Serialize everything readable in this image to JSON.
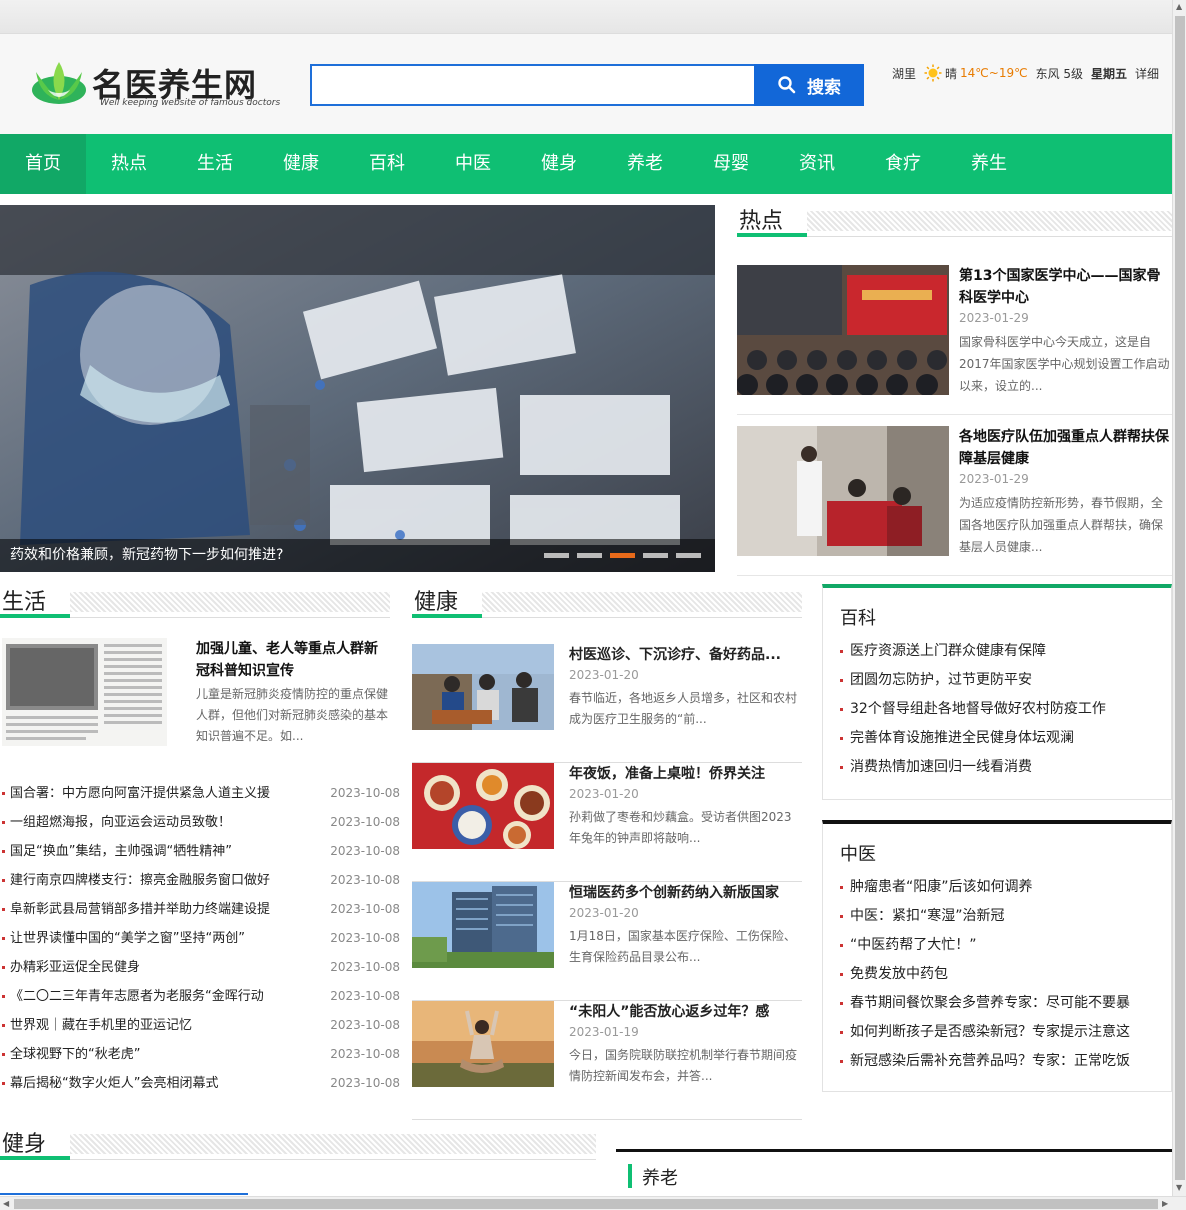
{
  "header": {
    "logo_title": "名医养生网",
    "logo_sub": "Well keeping website of famous doctors",
    "search_placeholder": "",
    "search_label": "搜索",
    "weather": {
      "city": "湖里",
      "condition": "晴",
      "temp": "14℃~19℃",
      "wind": "东风 5级",
      "day": "星期五",
      "detail": "详细"
    }
  },
  "nav": [
    "首页",
    "热点",
    "生活",
    "健康",
    "百科",
    "中医",
    "健身",
    "养老",
    "母婴",
    "资讯",
    "食疗",
    "养生"
  ],
  "slider": {
    "caption": "药效和价格兼顾，新冠药物下一步如何推进?",
    "dots": 5,
    "active_dot": 3
  },
  "sections": {
    "hot": "热点",
    "life": "生活",
    "health": "健康",
    "baike": "百科",
    "tcm": "中医",
    "fitness": "健身",
    "elderly": "养老"
  },
  "hot_items": [
    {
      "title": "第13个国家医学中心——国家骨科医学中心",
      "date": "2023-01-29",
      "summary": "国家骨科医学中心今天成立，这是自2017年国家医学中心规划设置工作启动以来，设立的..."
    },
    {
      "title": "各地医疗队伍加强重点人群帮扶保障基层健康",
      "date": "2023-01-29",
      "summary": "为适应疫情防控新形势，春节假期，全国各地医疗队加强重点人群帮扶，确保基层人员健康..."
    }
  ],
  "life_feature": {
    "title": "加强儿童、老人等重点人群新冠科普知识宣传",
    "summary": "儿童是新冠肺炎疫情防控的重点保健人群，但他们对新冠肺炎感染的基本知识普遍不足。如..."
  },
  "life_list": [
    {
      "title": "国合署：中方愿向阿富汗提供紧急人道主义援",
      "date": "2023-10-08"
    },
    {
      "title": "一组超燃海报，向亚运会运动员致敬！",
      "date": "2023-10-08"
    },
    {
      "title": "国足“换血”集结，主帅强调“牺牲精神”",
      "date": "2023-10-08"
    },
    {
      "title": "建行南京四牌楼支行：擦亮金融服务窗口做好",
      "date": "2023-10-08"
    },
    {
      "title": "阜新彰武县局营销部多措并举助力终端建设提",
      "date": "2023-10-08"
    },
    {
      "title": "让世界读懂中国的“美学之窗”坚持“两创”",
      "date": "2023-10-08"
    },
    {
      "title": "办精彩亚运促全民健身",
      "date": "2023-10-08"
    },
    {
      "title": "《二〇二三年青年志愿者为老服务“金晖行动",
      "date": "2023-10-08"
    },
    {
      "title": "世界观｜藏在手机里的亚运记忆",
      "date": "2023-10-08"
    },
    {
      "title": "全球视野下的“秋老虎”",
      "date": "2023-10-08"
    },
    {
      "title": "幕后揭秘“数字火炬人”会亮相闭幕式",
      "date": "2023-10-08"
    }
  ],
  "health_items": [
    {
      "title": "村医巡诊、下沉诊疗、备好药品...",
      "date": "2023-01-20",
      "summary": "春节临近，各地返乡人员增多，社区和农村成为医疗卫生服务的“前..."
    },
    {
      "title": "年夜饭，准备上桌啦！侨界关注",
      "date": "2023-01-20",
      "summary": "孙莉做了枣卷和炒藕盒。受访者供图2023年兔年的钟声即将敲响..."
    },
    {
      "title": "恒瑞医药多个创新药纳入新版国家",
      "date": "2023-01-20",
      "summary": "1月18日，国家基本医疗保险、工伤保险、生育保险药品目录公布..."
    },
    {
      "title": "“未阳人”能否放心返乡过年？感",
      "date": "2023-01-19",
      "summary": "今日，国务院联防联控机制举行春节期间疫情防控新闻发布会，并答..."
    }
  ],
  "baike_list": [
    "医疗资源送上门群众健康有保障",
    "团圆勿忘防护，过节更防平安",
    "32个督导组赴各地督导做好农村防疫工作",
    "完善体育设施推进全民健身体坛观澜",
    "消费热情加速回归一线看消费"
  ],
  "tcm_list": [
    "肿瘤患者“阳康”后该如何调养",
    "中医：紧扣“寒湿”治新冠",
    "“中医药帮了大忙！”",
    "免费发放中药包",
    "春节期间餐饮聚会多营养专家：尽可能不要暴",
    "如何判断孩子是否感染新冠？专家提示注意这",
    "新冠感染后需补充营养品吗？专家：正常吃饭"
  ],
  "colors": {
    "brand_green": "#0fbf73",
    "search_blue": "#1267d8",
    "accent_orange": "#e86a1a"
  }
}
